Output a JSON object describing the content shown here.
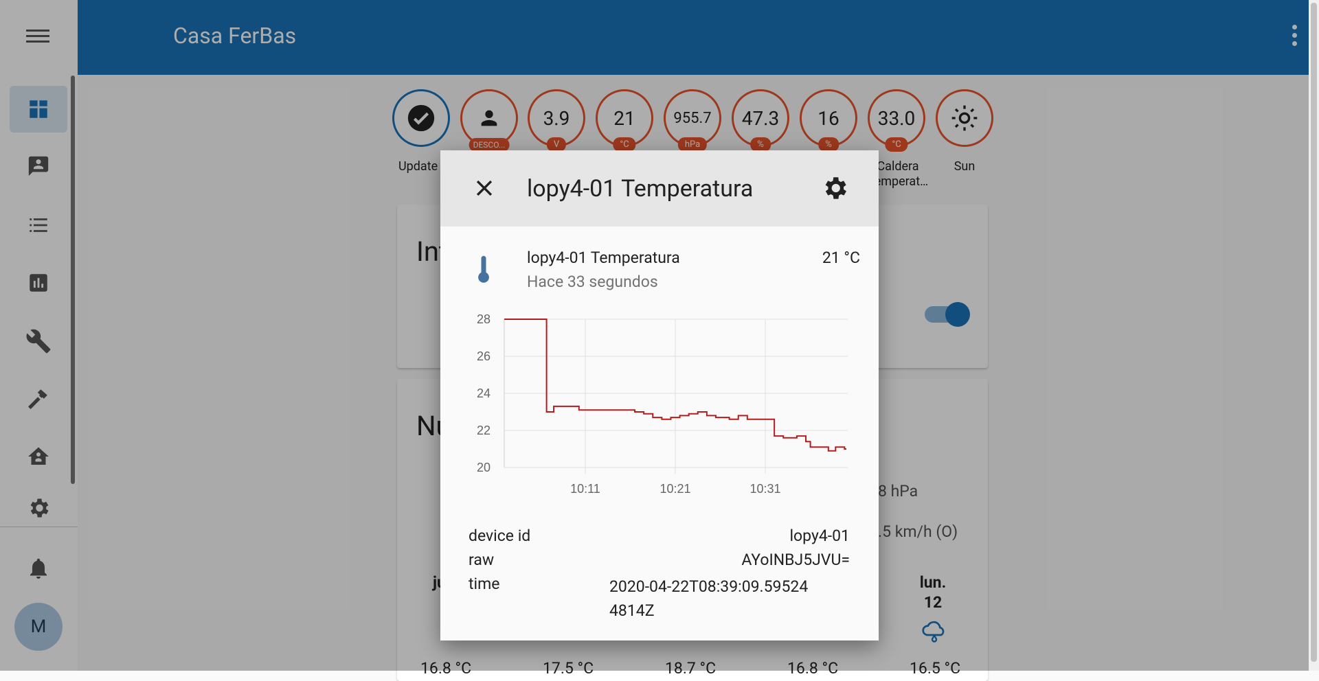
{
  "app": {
    "title": "Casa FerBas",
    "avatar_initial": "M"
  },
  "sidebar": {
    "items": [
      "dashboard-icon",
      "logbook-icon",
      "history-list-icon",
      "chart-icon",
      "wrench-icon",
      "hammer-icon",
      "home-automation-icon",
      "cog-icon",
      "bell-icon"
    ]
  },
  "badges": [
    {
      "value": "",
      "unit": "",
      "label": "Update",
      "icon": "check-circle-icon"
    },
    {
      "value": "",
      "unit": "DESCO...",
      "label": "",
      "icon": "person-icon"
    },
    {
      "value": "3.9",
      "unit": "V",
      "label": ""
    },
    {
      "value": "21",
      "unit": "°C",
      "label": ""
    },
    {
      "value": "955.7",
      "unit": "hPa",
      "label": ""
    },
    {
      "value": "47.3",
      "unit": "%",
      "label": ""
    },
    {
      "value": "16",
      "unit": "%",
      "label": ""
    },
    {
      "value": "33.0",
      "unit": "°C",
      "label": "Caldera Temperat…"
    },
    {
      "value": "",
      "unit": "",
      "label": "Sun",
      "icon": "sun-icon"
    }
  ],
  "background_cards": {
    "card1_title_fragment": "Int",
    "card2_title_fragment": "Nu",
    "pressure_fragment": "8 hPa",
    "wind_fragment": ".5 km/h (O)",
    "forecast_day_fragment": "ju",
    "forecast_day_last": "lun.",
    "forecast_date_last": "12",
    "forecast_temps": [
      "16.8 °C",
      "17.5 °C",
      "18.7 °C",
      "16.8 °C",
      "16.5 °C"
    ]
  },
  "dialog": {
    "title": "lopy4-01 Temperatura",
    "entity_name": "lopy4-01 Temperatura",
    "state": "21 °C",
    "last_changed": "Hace 33 segundos",
    "attributes": [
      {
        "key": "device id",
        "value": "lopy4-01"
      },
      {
        "key": "raw",
        "value": "AYoINBJ5JVU="
      },
      {
        "key": "time",
        "value": "2020-04-22T08:39:09.595244814Z"
      }
    ]
  },
  "chart_data": {
    "type": "line",
    "title": "",
    "xlabel": "",
    "ylabel": "",
    "ylim": [
      20,
      28
    ],
    "yticks": [
      20,
      22,
      24,
      26,
      28
    ],
    "xticks": [
      "10:11",
      "10:21",
      "10:31"
    ],
    "grid": true,
    "color": "#b71c1c",
    "series": [
      {
        "name": "",
        "step": true,
        "x": [
          "10:02",
          "10:06.7",
          "10:07.5",
          "10:08.3",
          "10:10.3",
          "10:11",
          "10:14",
          "10:16.5",
          "10:17.5",
          "10:18.5",
          "10:19.5",
          "10:20.5",
          "10:21.5",
          "10:22.5",
          "10:23.5",
          "10:24.5",
          "10:25.5",
          "10:27",
          "10:28",
          "10:29",
          "10:30",
          "10:32",
          "10:33",
          "10:34.5",
          "10:35.5",
          "10:36",
          "10:37",
          "10:38",
          "10:38.8",
          "10:39.8",
          "10:40"
        ],
        "values": [
          28,
          23.0,
          23.3,
          23.3,
          23.1,
          23.1,
          23.1,
          23.0,
          22.9,
          22.7,
          22.6,
          22.7,
          22.8,
          22.9,
          23.0,
          22.8,
          22.7,
          22.6,
          22.8,
          22.6,
          22.6,
          21.7,
          21.6,
          21.7,
          21.4,
          21.1,
          21.1,
          20.9,
          21.1,
          21.0,
          21.0
        ]
      }
    ]
  },
  "colors": {
    "header": "#1a74b8",
    "badge_border": "#e8532b",
    "chart_line": "#b71c1c"
  }
}
